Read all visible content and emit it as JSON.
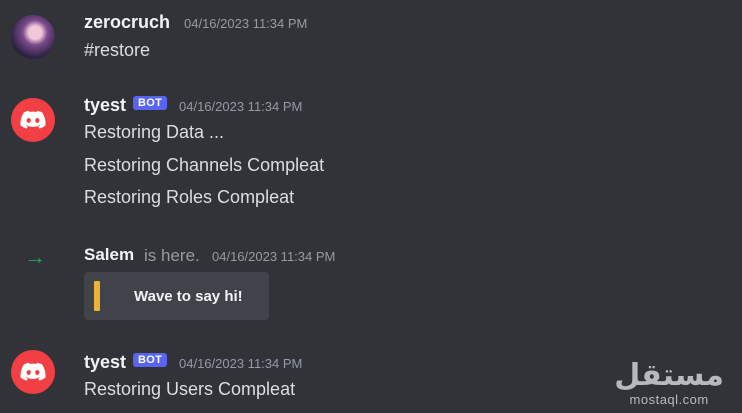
{
  "messages": [
    {
      "username": "zerocruch",
      "timestamp": "04/16/2023 11:34 PM",
      "lines": [
        "#restore"
      ]
    },
    {
      "username": "tyest",
      "badge": "BOT",
      "timestamp": "04/16/2023 11:34 PM",
      "lines": [
        "Restoring Data ...",
        "Restoring Channels Compleat",
        "Restoring Roles Compleat"
      ]
    },
    {
      "username": "tyest",
      "badge": "BOT",
      "timestamp": "04/16/2023 11:34 PM",
      "lines": [
        "Restoring Users Compleat"
      ]
    }
  ],
  "join": {
    "name": "Salem",
    "text": "is here.",
    "timestamp": "04/16/2023 11:34 PM",
    "wave_label": "Wave to say hi!"
  },
  "watermark": {
    "arabic": "مستقل",
    "latin": "mostaql.com"
  },
  "colors": {
    "background": "#313338",
    "bot_badge": "#5865f2",
    "bot_avatar": "#f23f43",
    "join_arrow": "#23a55a"
  }
}
